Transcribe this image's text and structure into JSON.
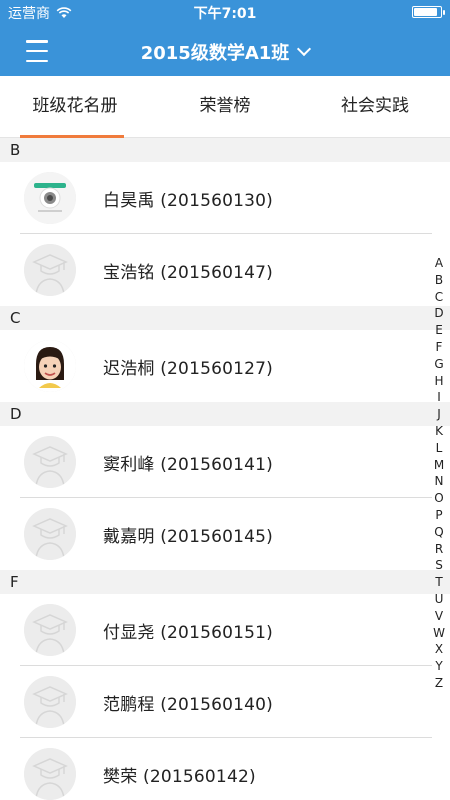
{
  "status_bar": {
    "carrier": "运营商",
    "time": "下午7:01",
    "battery_level": 0.9
  },
  "nav": {
    "class_title": "2015级数学A1班",
    "menu_icon": "hamburger-menu-icon",
    "dropdown_icon": "chevron-down-icon"
  },
  "tabs": [
    {
      "label": "班级花名册",
      "active": true
    },
    {
      "label": "荣誉榜",
      "active": false
    },
    {
      "label": "社会实践",
      "active": false
    }
  ],
  "roster": [
    {
      "letter": "B",
      "students": [
        {
          "name": "白昊禹 (201560130)",
          "avatar": "photo-logo"
        },
        {
          "name": "宝浩铭 (201560147)",
          "avatar": "default-graduate-icon"
        }
      ]
    },
    {
      "letter": "C",
      "students": [
        {
          "name": "迟浩桐 (201560127)",
          "avatar": "photo-child"
        }
      ]
    },
    {
      "letter": "D",
      "students": [
        {
          "name": "窦利峰 (201560141)",
          "avatar": "default-graduate-icon"
        },
        {
          "name": "戴嘉明 (201560145)",
          "avatar": "default-graduate-icon"
        }
      ]
    },
    {
      "letter": "F",
      "students": [
        {
          "name": "付显尧 (201560151)",
          "avatar": "default-graduate-icon"
        },
        {
          "name": "范鹏程 (201560140)",
          "avatar": "default-graduate-icon"
        },
        {
          "name": "樊荣 (201560142)",
          "avatar": "default-graduate-icon"
        }
      ]
    }
  ],
  "index_letters": [
    "A",
    "B",
    "C",
    "D",
    "E",
    "F",
    "G",
    "H",
    "I",
    "J",
    "K",
    "L",
    "M",
    "N",
    "O",
    "P",
    "Q",
    "R",
    "S",
    "T",
    "U",
    "V",
    "W",
    "X",
    "Y",
    "Z"
  ],
  "colors": {
    "header_blue": "#3a93d9",
    "tab_indicator": "#f07b3c",
    "section_bg": "#f2f2f2"
  }
}
